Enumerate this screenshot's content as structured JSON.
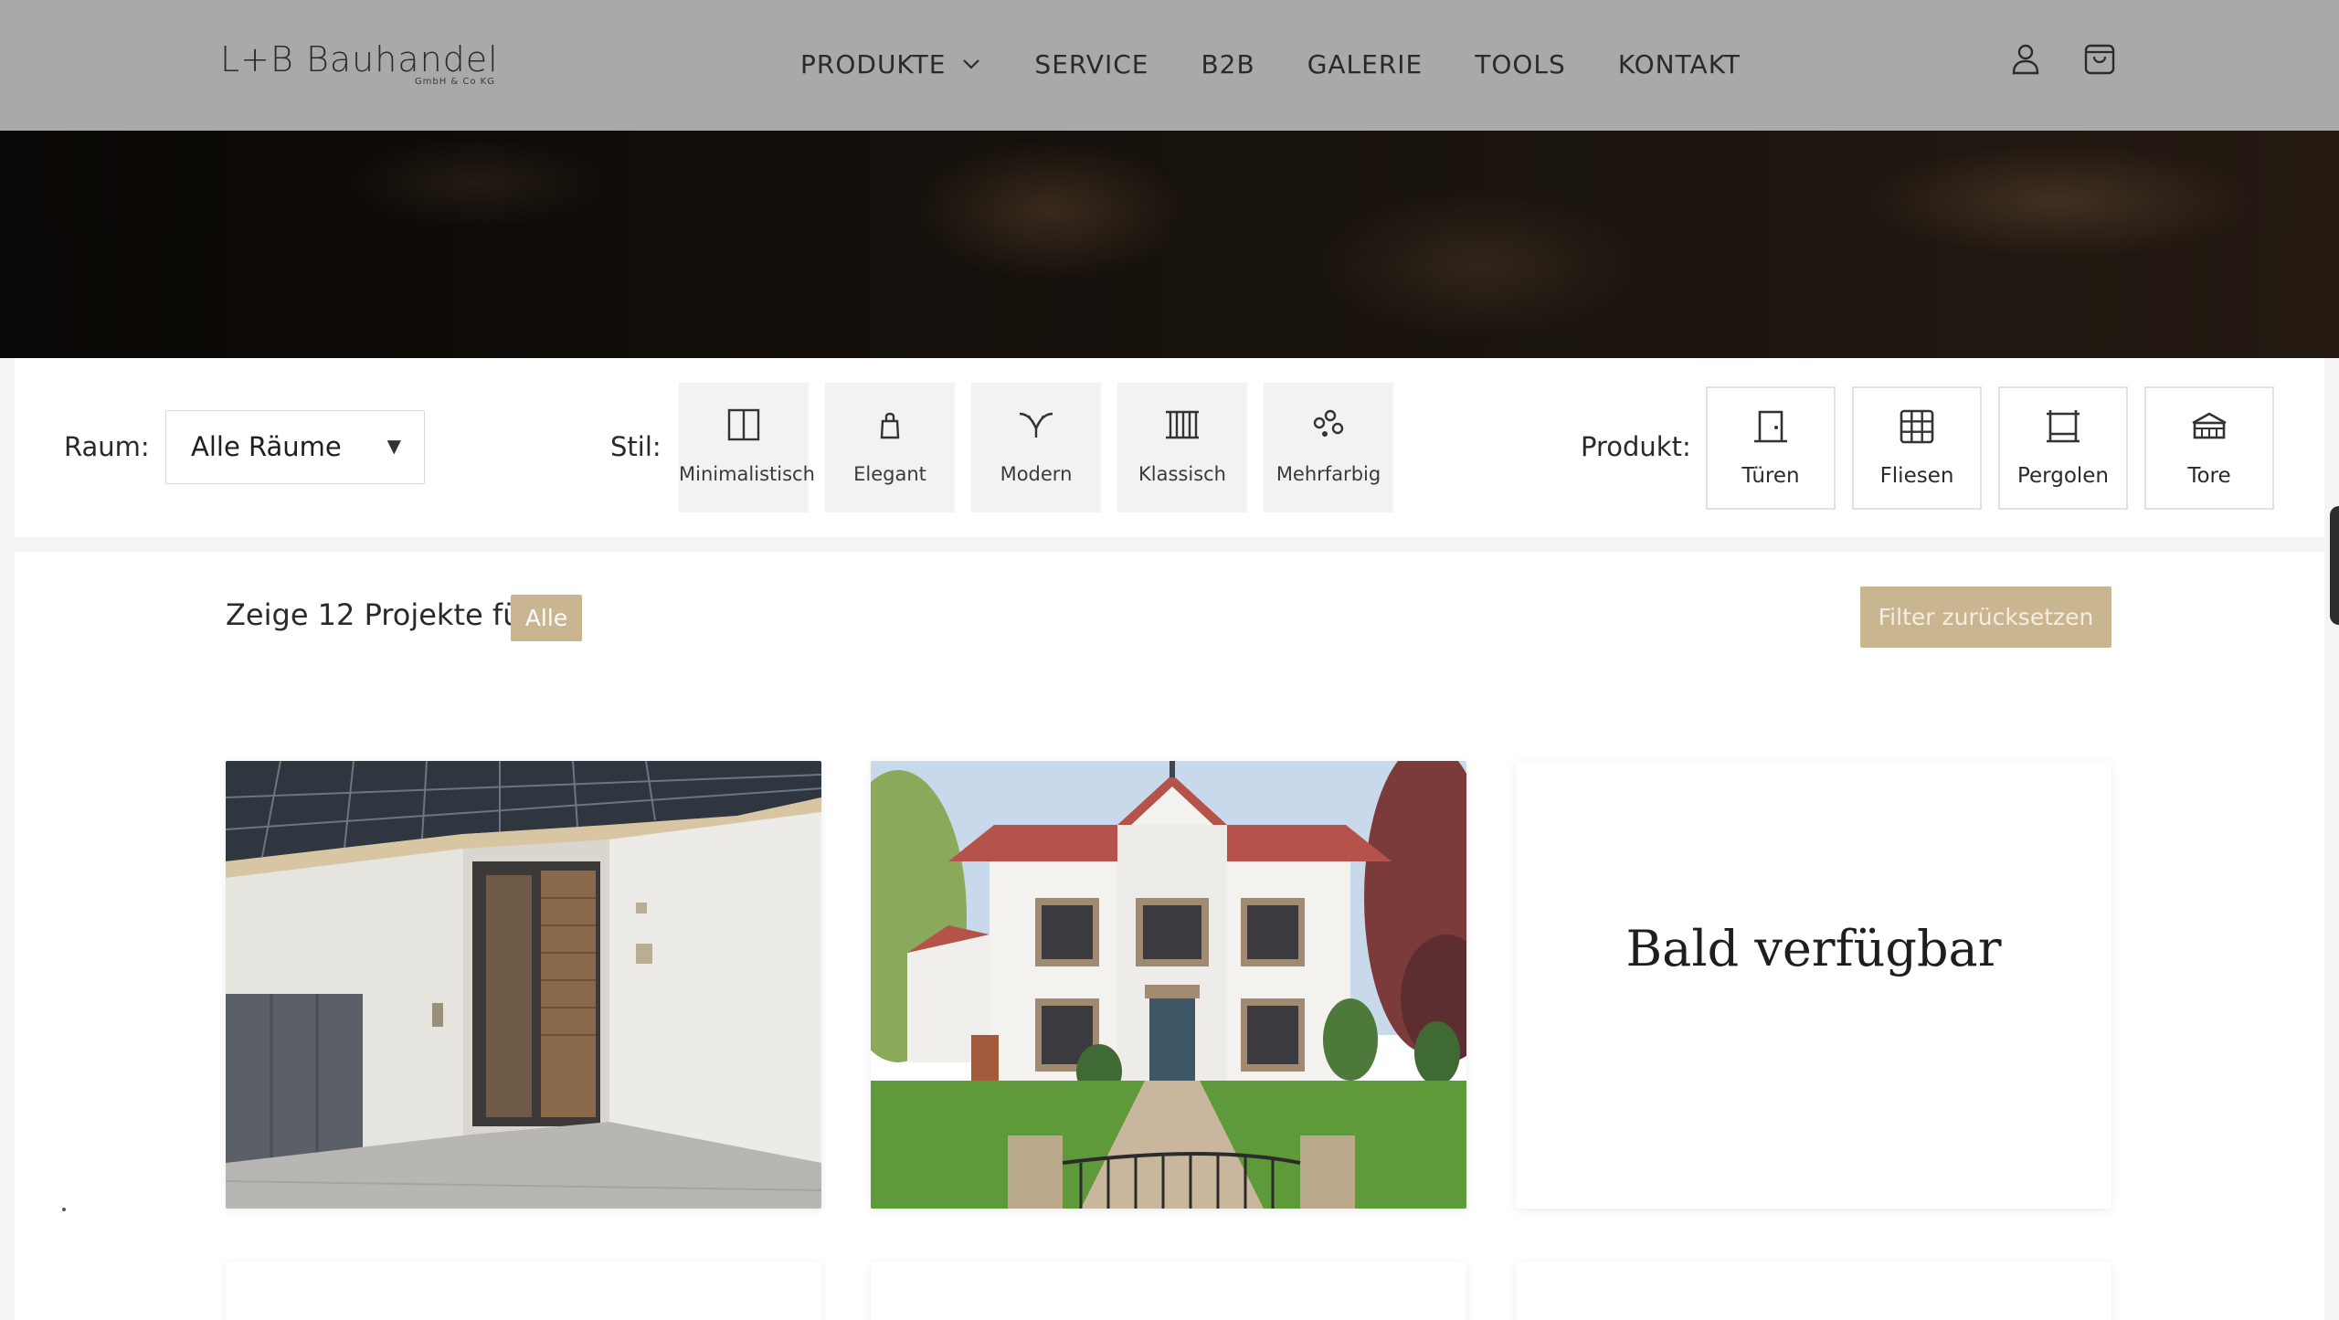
{
  "header": {
    "logo_main": "L+B Bauhandel",
    "logo_sub": "GmbH & Co KG",
    "nav": [
      {
        "label": "PRODUKTE",
        "has_dropdown": true
      },
      {
        "label": "SERVICE"
      },
      {
        "label": "B2B"
      },
      {
        "label": "GALERIE"
      },
      {
        "label": "TOOLS"
      },
      {
        "label": "KONTAKT"
      }
    ],
    "icons": [
      "user-icon",
      "shopping-bag-icon"
    ]
  },
  "filters": {
    "raum_label": "Raum:",
    "raum_value": "Alle Räume",
    "stil_label": "Stil:",
    "stil_options": [
      {
        "label": "Minimalistisch",
        "icon": "minimal-icon"
      },
      {
        "label": "Elegant",
        "icon": "elegant-icon"
      },
      {
        "label": "Modern",
        "icon": "modern-icon"
      },
      {
        "label": "Klassisch",
        "icon": "classic-icon"
      },
      {
        "label": "Mehrfarbig",
        "icon": "multicolor-icon"
      }
    ],
    "produkt_label": "Produkt:",
    "produkt_options": [
      {
        "label": "Türen",
        "icon": "door-icon"
      },
      {
        "label": "Fliesen",
        "icon": "tiles-icon"
      },
      {
        "label": "Pergolen",
        "icon": "pergola-icon"
      },
      {
        "label": "Tore",
        "icon": "gate-icon"
      }
    ]
  },
  "results": {
    "summary": "Zeige 12 Projekte für:",
    "active_tag": "Alle",
    "reset_label": "Filter zurücksetzen"
  },
  "cards": [
    {
      "type": "image",
      "subject": "entrance-pergola-photo"
    },
    {
      "type": "image",
      "subject": "villa-house-photo"
    },
    {
      "type": "placeholder",
      "text": "Bald verfügbar"
    }
  ],
  "colors": {
    "header_bg": "#a9a9a9",
    "accent_gold": "#c9b58f",
    "hero_dark": "#15100b"
  }
}
